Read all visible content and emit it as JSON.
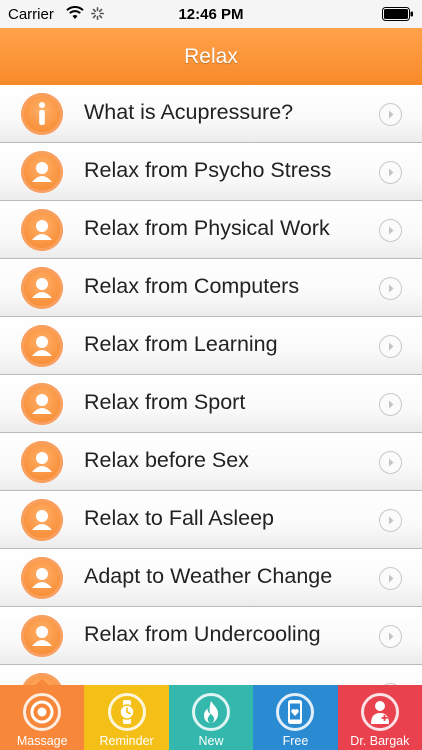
{
  "status": {
    "carrier": "Carrier",
    "time": "12:46 PM"
  },
  "nav": {
    "title": "Relax"
  },
  "list": [
    {
      "label": "What is Acupressure?",
      "icon": "info-icon"
    },
    {
      "label": "Relax from Psycho Stress",
      "icon": "person-icon"
    },
    {
      "label": "Relax from Physical Work",
      "icon": "person-icon"
    },
    {
      "label": "Relax from Computers",
      "icon": "person-icon"
    },
    {
      "label": "Relax from Learning",
      "icon": "person-icon"
    },
    {
      "label": "Relax from Sport",
      "icon": "person-icon"
    },
    {
      "label": "Relax before Sex",
      "icon": "person-icon"
    },
    {
      "label": "Relax to Fall Asleep",
      "icon": "person-icon"
    },
    {
      "label": "Adapt to Weather Change",
      "icon": "person-icon"
    },
    {
      "label": "Relax from Undercooling",
      "icon": "person-icon"
    },
    {
      "label": "",
      "icon": "person-icon"
    }
  ],
  "tabs": [
    {
      "label": "Massage",
      "color": "#f7873a",
      "icon": "target-icon",
      "active": true
    },
    {
      "label": "Reminder",
      "color": "#f4c017",
      "icon": "watch-icon",
      "active": false
    },
    {
      "label": "New",
      "color": "#34b8ad",
      "icon": "flame-icon",
      "active": false
    },
    {
      "label": "Free",
      "color": "#2b8bd2",
      "icon": "phone-heart-icon",
      "active": false
    },
    {
      "label": "Dr. Bargak",
      "color": "#e9414e",
      "icon": "doctor-icon",
      "active": false
    }
  ]
}
